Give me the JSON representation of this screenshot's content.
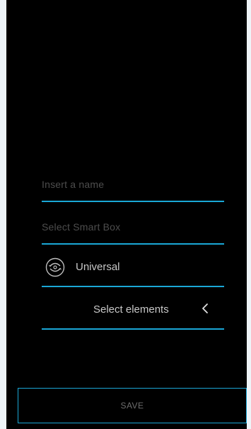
{
  "form": {
    "name_placeholder": "Insert a name",
    "smartbox_placeholder": "Select Smart Box",
    "universal_label": "Universal",
    "universal_icon": "universal-remote-icon",
    "elements_label": "Select elements",
    "elements_icon": "chevron-left-icon"
  },
  "actions": {
    "save_label": "SAVE"
  },
  "colors": {
    "background": "#000000",
    "accent": "#1aa7d6",
    "placeholder": "#4d4d4d",
    "text": "#c8c8c8"
  }
}
